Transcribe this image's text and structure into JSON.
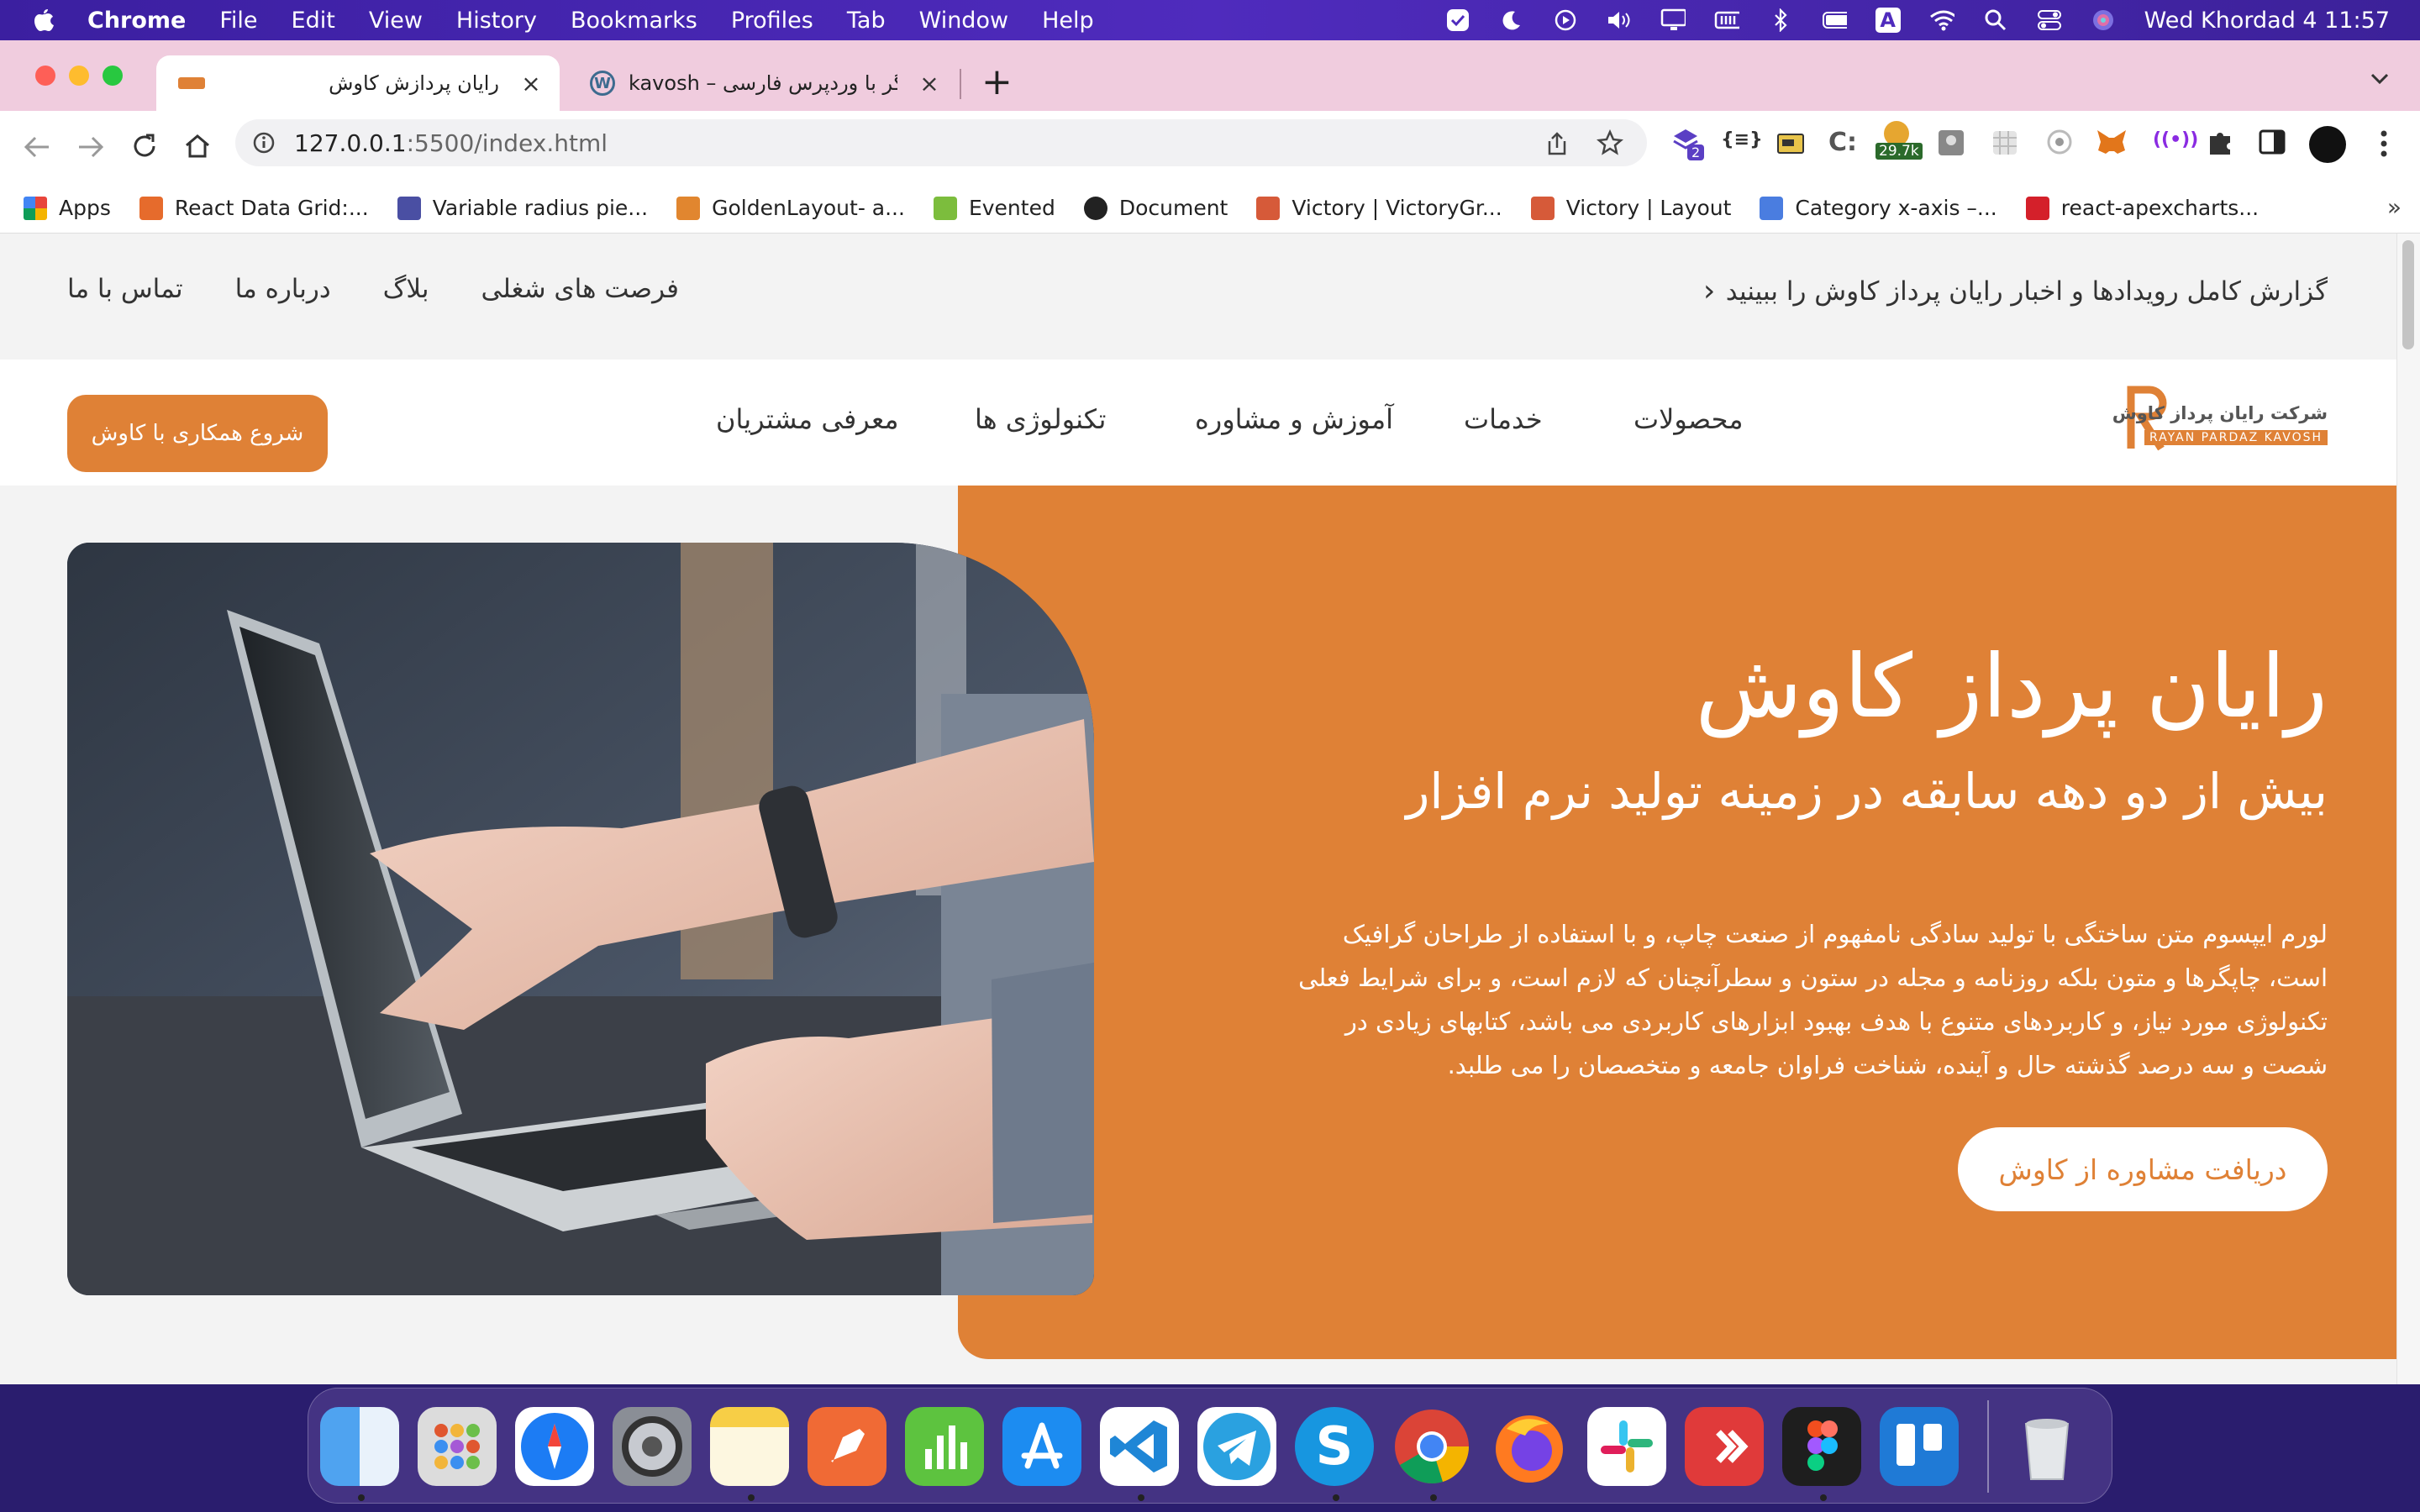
{
  "menubar": {
    "app": "Chrome",
    "items": [
      "File",
      "Edit",
      "View",
      "History",
      "Bookmarks",
      "Profiles",
      "Tab",
      "Window",
      "Help"
    ],
    "clock": "Wed Khordad 4  11:57",
    "input_source": "A"
  },
  "tabs": [
    {
      "title": "رایان پردازش کاوش",
      "close": "×",
      "favicon": "kavosh-logo-icon"
    },
    {
      "title": "kavosh – یک سایت دیگر با وردپرس فارسی",
      "close": "×",
      "favicon": "wordpress-icon"
    }
  ],
  "newtab": "+",
  "address": {
    "host": "127.0.0.1",
    "path": ":5500/index.html"
  },
  "extensions": {
    "badge1": "2",
    "badge2": "29.7k"
  },
  "bookmarks": [
    {
      "label": "Apps",
      "icon": "apps-grid-icon",
      "color": "#e8453c"
    },
    {
      "label": "React Data Grid:...",
      "icon": "react-grid-icon",
      "color": "#e66b2c"
    },
    {
      "label": "Variable radius pie...",
      "icon": "highcharts-icon",
      "color": "#4a4fa3"
    },
    {
      "label": "GoldenLayout- a...",
      "icon": "goldenlayout-icon",
      "color": "#e1862f"
    },
    {
      "label": "Evented",
      "icon": "leaf-icon",
      "color": "#7cbd3d"
    },
    {
      "label": "Document",
      "icon": "globe-icon",
      "color": "#222222"
    },
    {
      "label": "Victory | VictoryGr...",
      "icon": "victory-icon",
      "color": "#d65a39"
    },
    {
      "label": "Victory | Layout",
      "icon": "victory-icon",
      "color": "#d65a39"
    },
    {
      "label": "Category x-axis –...",
      "icon": "triangle-icon",
      "color": "#4a7de0"
    },
    {
      "label": "react-apexcharts...",
      "icon": "apex-icon",
      "color": "#d4202a"
    }
  ],
  "bookmarks_more": "»",
  "site": {
    "topbar": {
      "report": "گزارش کامل رویدادها و اخبار رایان پرداز کاوش را ببینید",
      "chevron": "›",
      "links": [
        "فرصت های شغلی",
        "بلاگ",
        "درباره ما",
        "تماس با ما"
      ]
    },
    "logo": {
      "fa": "شرکت رایان پرداز کاوش",
      "en": "RAYAN PARDAZ KAVOSH"
    },
    "nav": [
      "محصولات",
      "خدمات",
      "آموزش و مشاوره",
      "تکنولوژی ها",
      "معرفی مشتریان"
    ],
    "cta": "شروع همکاری با کاوش",
    "hero": {
      "title": "رایان پرداز کاوش",
      "subtitle": "بیش از دو دهه سابقه در زمینه تولید نرم افزار",
      "lines": [
        "لورم ایپسوم متن ساختگی با تولید سادگی نامفهوم از صنعت چاپ، و با استفاده از طراحان گرافیک",
        "است، چاپگرها و متون بلکه روزنامه و مجله در ستون و سطرآنچنان که لازم است، و برای شرایط فعلی",
        "تکنولوژی مورد نیاز، و کاربردهای متنوع با هدف بهبود ابزارهای کاربردی می باشد، کتابهای زیادی در",
        "شصت و سه درصد گذشته حال و آینده، شناخت فراوان جامعه و متخصصان را می طلبد."
      ],
      "button": "دریافت مشاوره از کاوش"
    },
    "accent": "#df8136"
  }
}
